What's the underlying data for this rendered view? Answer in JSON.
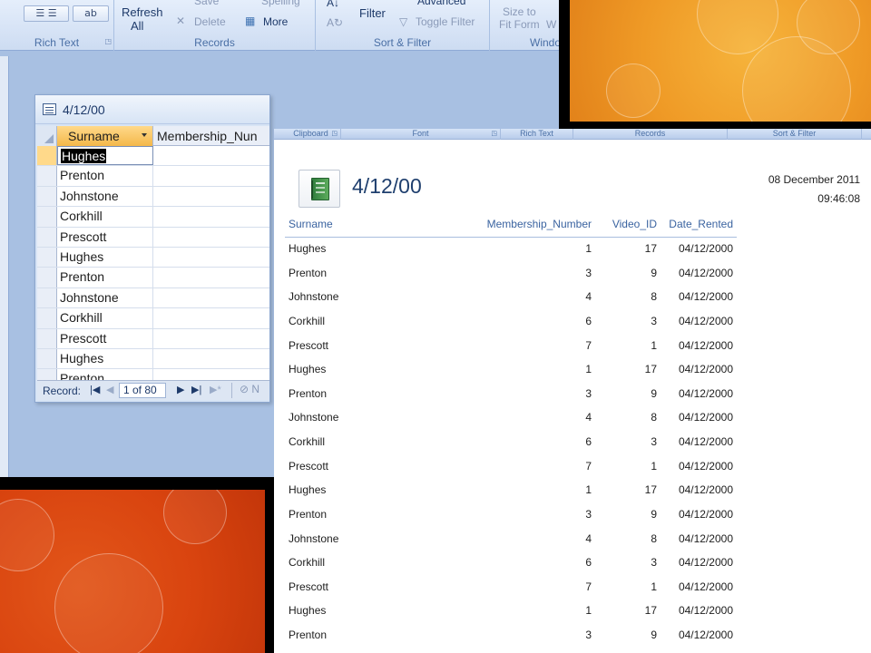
{
  "back_window": {
    "ribbon": {
      "groups": [
        {
          "label": "Rich Text"
        },
        {
          "label": "Records"
        },
        {
          "label": "Sort & Filter"
        },
        {
          "label": "Windo"
        }
      ],
      "refresh_label": "Refresh",
      "refresh_sub": "All",
      "save_label": "Save",
      "delete_label": "Delete",
      "more_label": "More",
      "spelling_label": "Spelling",
      "filter_label": "Filter",
      "advanced_label": "Advanced",
      "toggle_filter_label": "Toggle Filter",
      "size_to_label": "Size to",
      "fit_form_label": "Fit Form",
      "fit_form_extra": "W"
    },
    "datasheet": {
      "title": "4/12/00",
      "columns": [
        "Surname",
        "Membership_Nun"
      ],
      "rows": [
        "Hughes",
        "Prenton",
        "Johnstone",
        "Corkhill",
        "Prescott",
        "Hughes",
        "Prenton",
        "Johnstone",
        "Corkhill",
        "Prescott",
        "Hughes",
        "Prenton"
      ],
      "nav": {
        "label": "Record:",
        "position": "1 of 80",
        "filter_text": "N"
      }
    }
  },
  "front_window": {
    "ribbon_groups": [
      "Clipboard",
      "Font",
      "Rich Text",
      "Records",
      "Sort & Filter"
    ],
    "report": {
      "title": "4/12/00",
      "date": "08 December 2011",
      "time": "09:46:08",
      "columns": [
        "Surname",
        "Membership_Number",
        "Video_ID",
        "Date_Rented"
      ],
      "rows": [
        {
          "surname": "Hughes",
          "membership": "1",
          "video": "17",
          "date": "04/12/2000"
        },
        {
          "surname": "Prenton",
          "membership": "3",
          "video": "9",
          "date": "04/12/2000"
        },
        {
          "surname": "Johnstone",
          "membership": "4",
          "video": "8",
          "date": "04/12/2000"
        },
        {
          "surname": "Corkhill",
          "membership": "6",
          "video": "3",
          "date": "04/12/2000"
        },
        {
          "surname": "Prescott",
          "membership": "7",
          "video": "1",
          "date": "04/12/2000"
        },
        {
          "surname": "Hughes",
          "membership": "1",
          "video": "17",
          "date": "04/12/2000"
        },
        {
          "surname": "Prenton",
          "membership": "3",
          "video": "9",
          "date": "04/12/2000"
        },
        {
          "surname": "Johnstone",
          "membership": "4",
          "video": "8",
          "date": "04/12/2000"
        },
        {
          "surname": "Corkhill",
          "membership": "6",
          "video": "3",
          "date": "04/12/2000"
        },
        {
          "surname": "Prescott",
          "membership": "7",
          "video": "1",
          "date": "04/12/2000"
        },
        {
          "surname": "Hughes",
          "membership": "1",
          "video": "17",
          "date": "04/12/2000"
        },
        {
          "surname": "Prenton",
          "membership": "3",
          "video": "9",
          "date": "04/12/2000"
        },
        {
          "surname": "Johnstone",
          "membership": "4",
          "video": "8",
          "date": "04/12/2000"
        },
        {
          "surname": "Corkhill",
          "membership": "6",
          "video": "3",
          "date": "04/12/2000"
        },
        {
          "surname": "Prescott",
          "membership": "7",
          "video": "1",
          "date": "04/12/2000"
        },
        {
          "surname": "Hughes",
          "membership": "1",
          "video": "17",
          "date": "04/12/2000"
        },
        {
          "surname": "Prenton",
          "membership": "3",
          "video": "9",
          "date": "04/12/2000"
        }
      ]
    }
  },
  "icons": [
    "datasheet-icon",
    "report-book-icon",
    "column-dropdown-icon",
    "first-record-icon",
    "prev-record-icon",
    "next-record-icon",
    "last-record-icon",
    "new-record-icon",
    "no-filter-icon",
    "delete-icon",
    "toggle-filter-icon",
    "sort-icon"
  ],
  "colors": {
    "accent_blue": "#1f3f6e",
    "header_orange": "#f4b84a",
    "ribbon_blue": "#cddcf2",
    "bg_orange": "#ef9a26",
    "bg_red_orange": "#d9440f"
  }
}
